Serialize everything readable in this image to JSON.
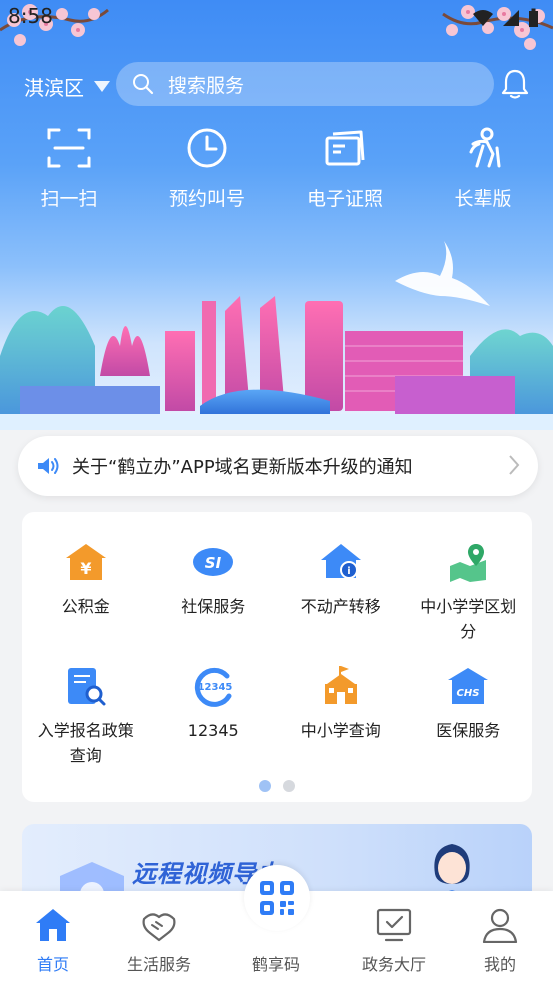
{
  "status": {
    "time": "8:58"
  },
  "header": {
    "district": "淇滨区",
    "search_placeholder": "搜索服务"
  },
  "quick_actions": [
    {
      "label": "扫一扫",
      "icon": "scan-icon"
    },
    {
      "label": "预约叫号",
      "icon": "clock-icon"
    },
    {
      "label": "电子证照",
      "icon": "cards-icon"
    },
    {
      "label": "长辈版",
      "icon": "elder-icon"
    }
  ],
  "notice": {
    "text": "关于“鹤立办”APP域名更新版本升级的通知"
  },
  "services": [
    {
      "label": "公积金",
      "icon": "housing-fund-icon"
    },
    {
      "label": "社保服务",
      "icon": "social-security-icon"
    },
    {
      "label": "不动产转移",
      "icon": "real-estate-icon"
    },
    {
      "label": "中小学学区划分",
      "icon": "map-pin-icon"
    },
    {
      "label": "入学报名政策查询",
      "icon": "doc-search-icon"
    },
    {
      "label": "12345",
      "icon": "hotline-12345-icon"
    },
    {
      "label": "中小学查询",
      "icon": "school-icon"
    },
    {
      "label": "医保服务",
      "icon": "medical-insurance-icon"
    }
  ],
  "pager": {
    "pages": 2,
    "current": 1
  },
  "banner": {
    "title": "远程视频导办"
  },
  "tabbar": [
    {
      "label": "首页",
      "icon": "home-icon",
      "active": true
    },
    {
      "label": "生活服务",
      "icon": "handshake-icon",
      "active": false
    },
    {
      "label": "鹤享码",
      "icon": "qr-code-icon",
      "active": false
    },
    {
      "label": "政务大厅",
      "icon": "monitor-check-icon",
      "active": false
    },
    {
      "label": "我的",
      "icon": "user-icon",
      "active": false
    }
  ],
  "colors": {
    "accent": "#2f7cf6",
    "hero_top": "#3f8cf5",
    "orange": "#f39a2b"
  }
}
